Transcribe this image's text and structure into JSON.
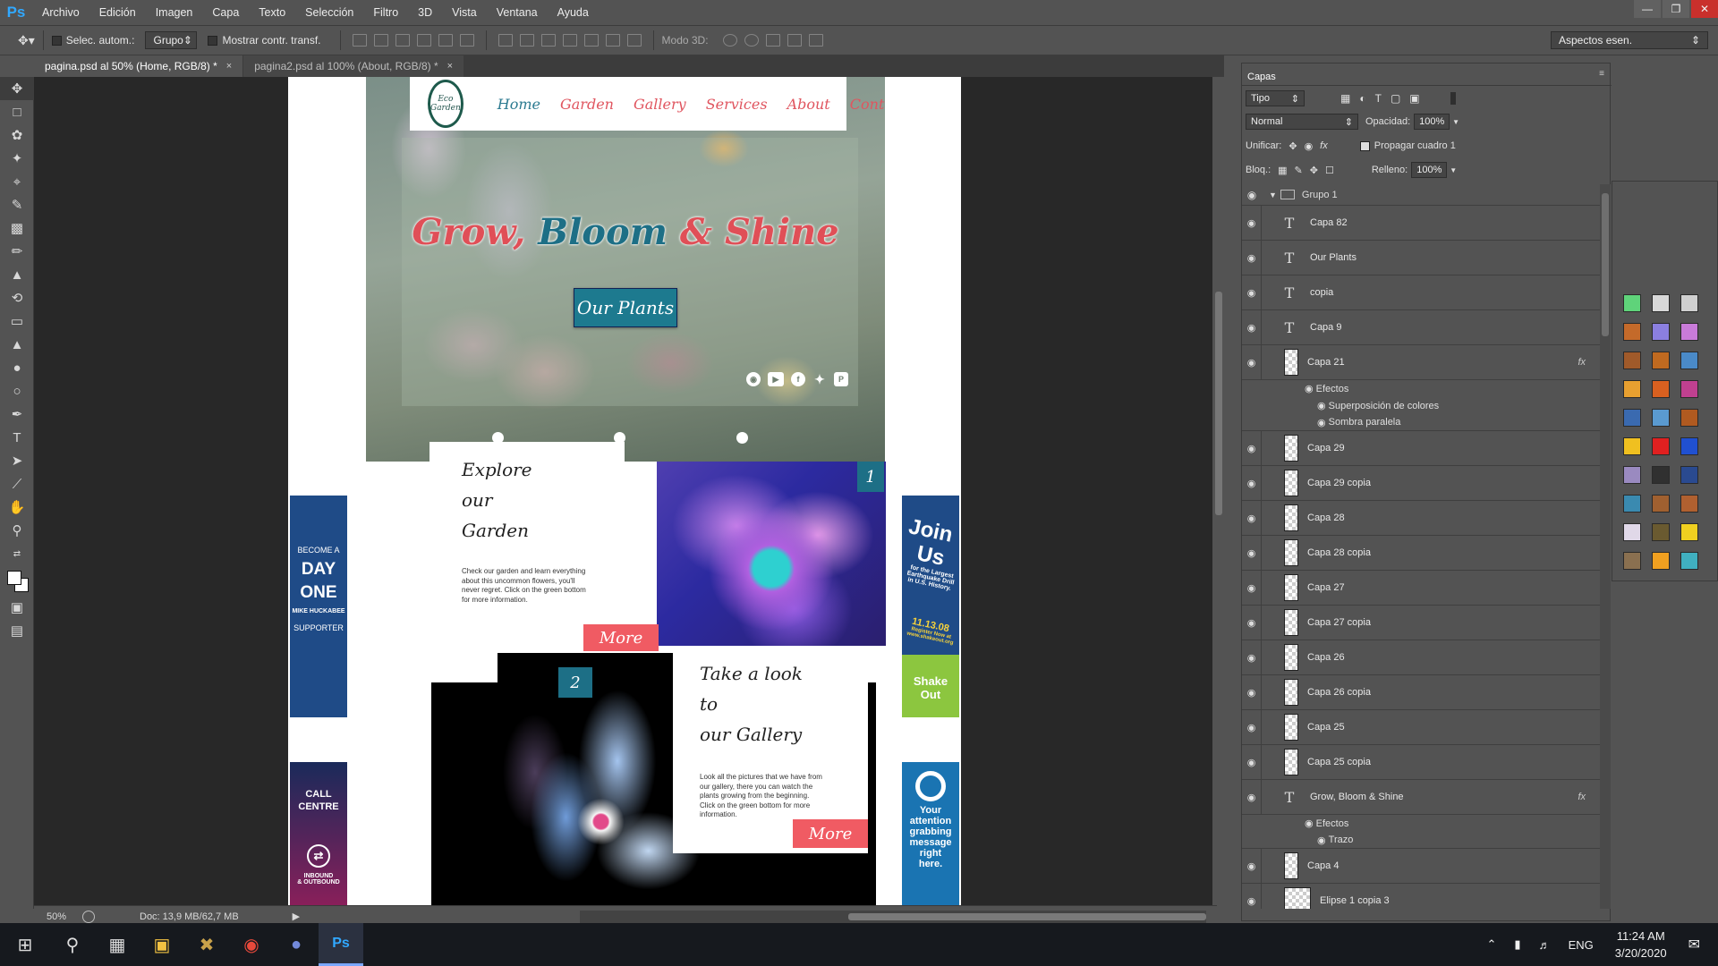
{
  "app": {
    "logo": "Ps"
  },
  "menu": [
    "Archivo",
    "Edición",
    "Imagen",
    "Capa",
    "Texto",
    "Selección",
    "Filtro",
    "3D",
    "Vista",
    "Ventana",
    "Ayuda"
  ],
  "options": {
    "auto_select_label": "Selec. autom.:",
    "auto_select_value": "Grupo",
    "transform_label": "Mostrar contr. transf.",
    "mode3d_label": "Modo 3D:",
    "workspace": "Aspectos esen."
  },
  "tabs": [
    {
      "label": "pagina.psd al 50% (Home, RGB/8) *",
      "close": "×"
    },
    {
      "label": "pagina2.psd al 100% (About, RGB/8) *",
      "close": "×"
    }
  ],
  "status": {
    "zoom": "50%",
    "doc": "Doc: 13,9 MB/62,7 MB"
  },
  "site": {
    "logo_top": "Eco",
    "logo_bottom": "Garden",
    "nav": [
      "Home",
      "Garden",
      "Gallery",
      "Services",
      "About",
      "Contact"
    ],
    "hero_title_1": "Grow, ",
    "hero_title_2": "Bloom",
    "hero_title_3": " & ",
    "hero_title_4": "Shine",
    "hero_button": "Our Plants",
    "social_icons": [
      "instagram-icon",
      "youtube-icon",
      "facebook-icon",
      "twitter-icon",
      "pinterest-icon"
    ],
    "card1": {
      "badge": "1",
      "title_lines": [
        "Explore",
        "our",
        "Garden"
      ],
      "body": "Check our garden and learn everything about this uncommon flowers, you'll never regret. Click on the green bottom for more information.",
      "button": "More"
    },
    "card2": {
      "badge": "2",
      "title_lines": [
        "Take a look",
        "to",
        "our Gallery"
      ],
      "body": "Look all the pictures that we have from our gallery, there you can watch the plants growing from the beginning. Click on the green bottom for more information.",
      "button": "More"
    },
    "ads": {
      "ad1": [
        "BECOME A",
        "DAY",
        "ONE",
        "MIKE HUCKABEE",
        "SUPPORTER"
      ],
      "ad2": [
        "CALL",
        "CENTRE",
        "INBOUND",
        "& OUTBOUND"
      ],
      "ad3": [
        "Join",
        "Us",
        "for the Largest Earthquake Drill in U.S. History.",
        "11.13.08",
        "Register Now at www.shakeout.org",
        "Shake Out"
      ],
      "ad4": [
        "Your",
        "attention",
        "grabbing",
        "message",
        "right",
        "here."
      ]
    }
  },
  "layers_panel": {
    "tab": "Capas",
    "filter": "Tipo",
    "blend": "Normal",
    "opacity_label": "Opacidad:",
    "opacity": "100%",
    "unify_label": "Unificar:",
    "propagate_label": "Propagar cuadro 1",
    "lock_label": "Bloq.:",
    "fill_label": "Relleno:",
    "fill": "100%",
    "group": "Grupo 1",
    "layers": [
      {
        "name": "Capa 82",
        "type": "text"
      },
      {
        "name": "Our Plants",
        "type": "text"
      },
      {
        "name": "copia",
        "type": "text"
      },
      {
        "name": "Capa 9",
        "type": "text"
      },
      {
        "name": "Capa 21",
        "type": "pixel",
        "fx": "fx",
        "effects": [
          "Efectos",
          "Superposición de colores",
          "Sombra paralela"
        ]
      },
      {
        "name": "Capa 29",
        "type": "pixel"
      },
      {
        "name": "Capa 29 copia",
        "type": "pixel"
      },
      {
        "name": "Capa 28",
        "type": "pixel"
      },
      {
        "name": "Capa 28 copia",
        "type": "pixel"
      },
      {
        "name": "Capa 27",
        "type": "pixel"
      },
      {
        "name": "Capa 27 copia",
        "type": "pixel"
      },
      {
        "name": "Capa 26",
        "type": "pixel"
      },
      {
        "name": "Capa 26 copia",
        "type": "pixel"
      },
      {
        "name": "Capa 25",
        "type": "pixel"
      },
      {
        "name": "Capa 25 copia",
        "type": "pixel"
      },
      {
        "name": "Grow, Bloom & Shine",
        "type": "text",
        "fx": "fx",
        "effects": [
          "Efectos",
          "Trazo"
        ]
      },
      {
        "name": "Capa 4",
        "type": "pixel"
      },
      {
        "name": "Elipse 1 copia 3",
        "type": "pixel"
      }
    ]
  },
  "taskbar": {
    "lang": "ENG",
    "time": "11:24 AM",
    "date": "3/20/2020"
  }
}
